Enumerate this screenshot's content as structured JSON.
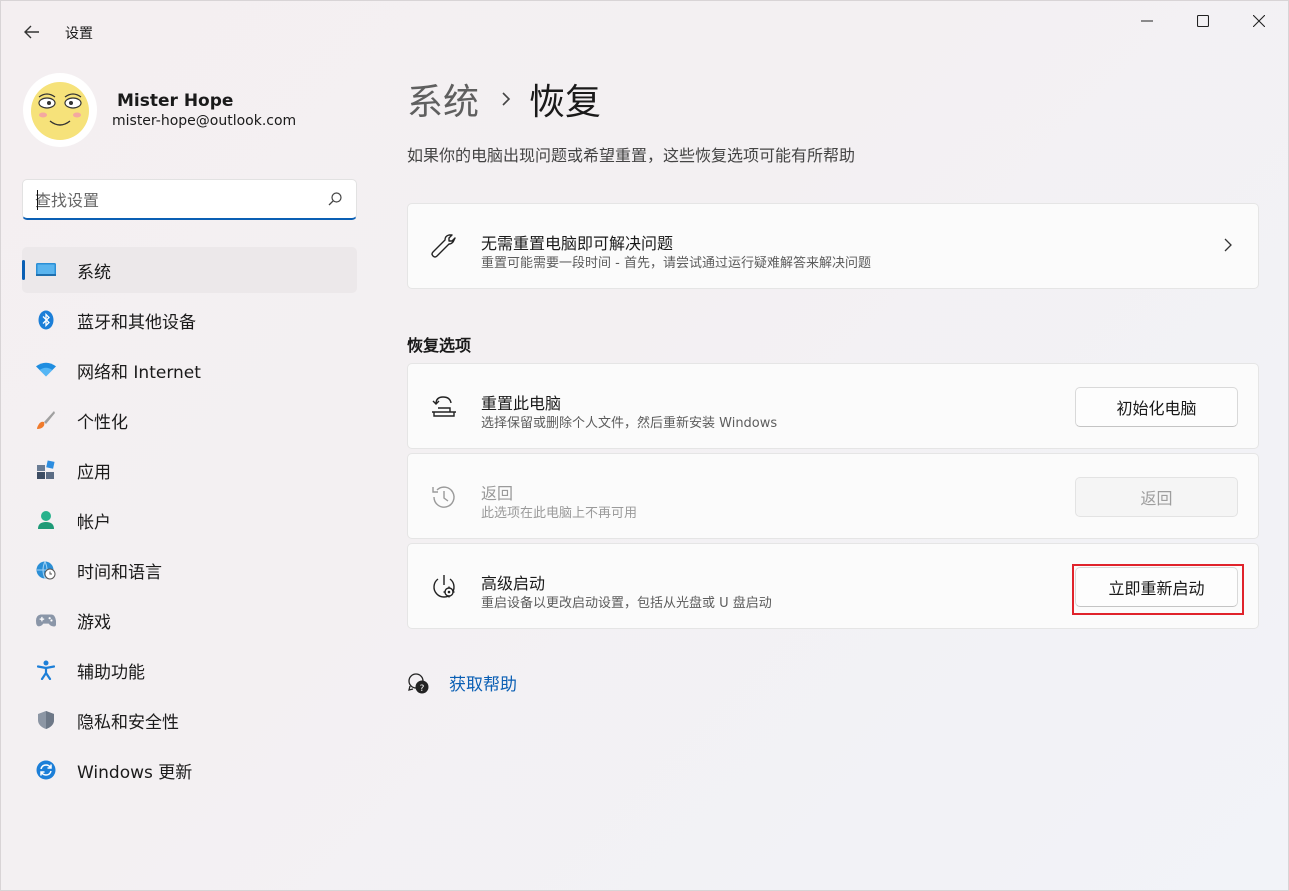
{
  "app": {
    "title": "设置"
  },
  "user": {
    "name": "Mister Hope",
    "email": "mister-hope@outlook.com"
  },
  "search": {
    "placeholder": "查找设置",
    "value": ""
  },
  "sidebar": {
    "items": [
      {
        "label": "系统",
        "icon": "system-display-icon",
        "active": true
      },
      {
        "label": "蓝牙和其他设备",
        "icon": "bluetooth-icon",
        "active": false
      },
      {
        "label": "网络和 Internet",
        "icon": "wifi-icon",
        "active": false
      },
      {
        "label": "个性化",
        "icon": "paintbrush-icon",
        "active": false
      },
      {
        "label": "应用",
        "icon": "apps-icon",
        "active": false
      },
      {
        "label": "帐户",
        "icon": "account-icon",
        "active": false
      },
      {
        "label": "时间和语言",
        "icon": "globe-clock-icon",
        "active": false
      },
      {
        "label": "游戏",
        "icon": "gamepad-icon",
        "active": false
      },
      {
        "label": "辅助功能",
        "icon": "accessibility-icon",
        "active": false
      },
      {
        "label": "隐私和安全性",
        "icon": "shield-icon",
        "active": false
      },
      {
        "label": "Windows 更新",
        "icon": "windows-update-icon",
        "active": false
      }
    ]
  },
  "main": {
    "breadcrumb": {
      "parent": "系统",
      "current": "恢复"
    },
    "description": "如果你的电脑出现问题或希望重置，这些恢复选项可能有所帮助",
    "troubleshoot_card": {
      "title": "无需重置电脑即可解决问题",
      "subtitle": "重置可能需要一段时间 - 首先，请尝试通过运行疑难解答来解决问题",
      "icon": "wrench-icon"
    },
    "section_label": "恢复选项",
    "recovery_options": [
      {
        "title": "重置此电脑",
        "subtitle": "选择保留或删除个人文件，然后重新安装 Windows",
        "button": "初始化电脑",
        "icon": "reset-pc-icon",
        "enabled": true
      },
      {
        "title": "返回",
        "subtitle": "此选项在此电脑上不再可用",
        "button": "返回",
        "icon": "history-icon",
        "enabled": false
      },
      {
        "title": "高级启动",
        "subtitle": "重启设备以更改启动设置，包括从光盘或 U 盘启动",
        "button": "立即重新启动",
        "icon": "advanced-startup-icon",
        "enabled": true,
        "highlighted": true
      }
    ],
    "help_link": "获取帮助"
  },
  "colors": {
    "accent": "#0a5fb4",
    "highlight": "#e0232b"
  }
}
